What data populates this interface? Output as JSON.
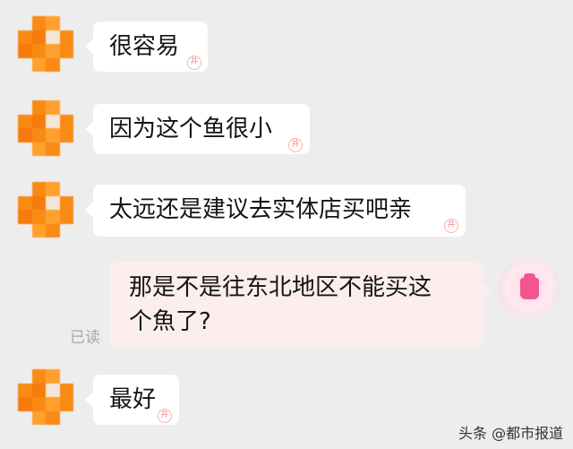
{
  "messages": [
    {
      "from": "other",
      "text": "很容易"
    },
    {
      "from": "other",
      "text": "因为这个鱼很小"
    },
    {
      "from": "other",
      "text": "太远还是建议去实体店买吧亲"
    },
    {
      "from": "me",
      "text": "那是不是往东北地区不能买这个魚了?",
      "line1": "那是不是往东北地区不能买这",
      "line2": "个魚了?",
      "status": "已读"
    },
    {
      "from": "other",
      "text": "最好"
    }
  ],
  "watermark_mark": "井",
  "footer": {
    "source": "头条 @都市报道"
  },
  "colors": {
    "background": "#ededed",
    "other_bubble": "#ffffff",
    "my_bubble": "#fdeeee",
    "avatar": "#f98a14"
  }
}
